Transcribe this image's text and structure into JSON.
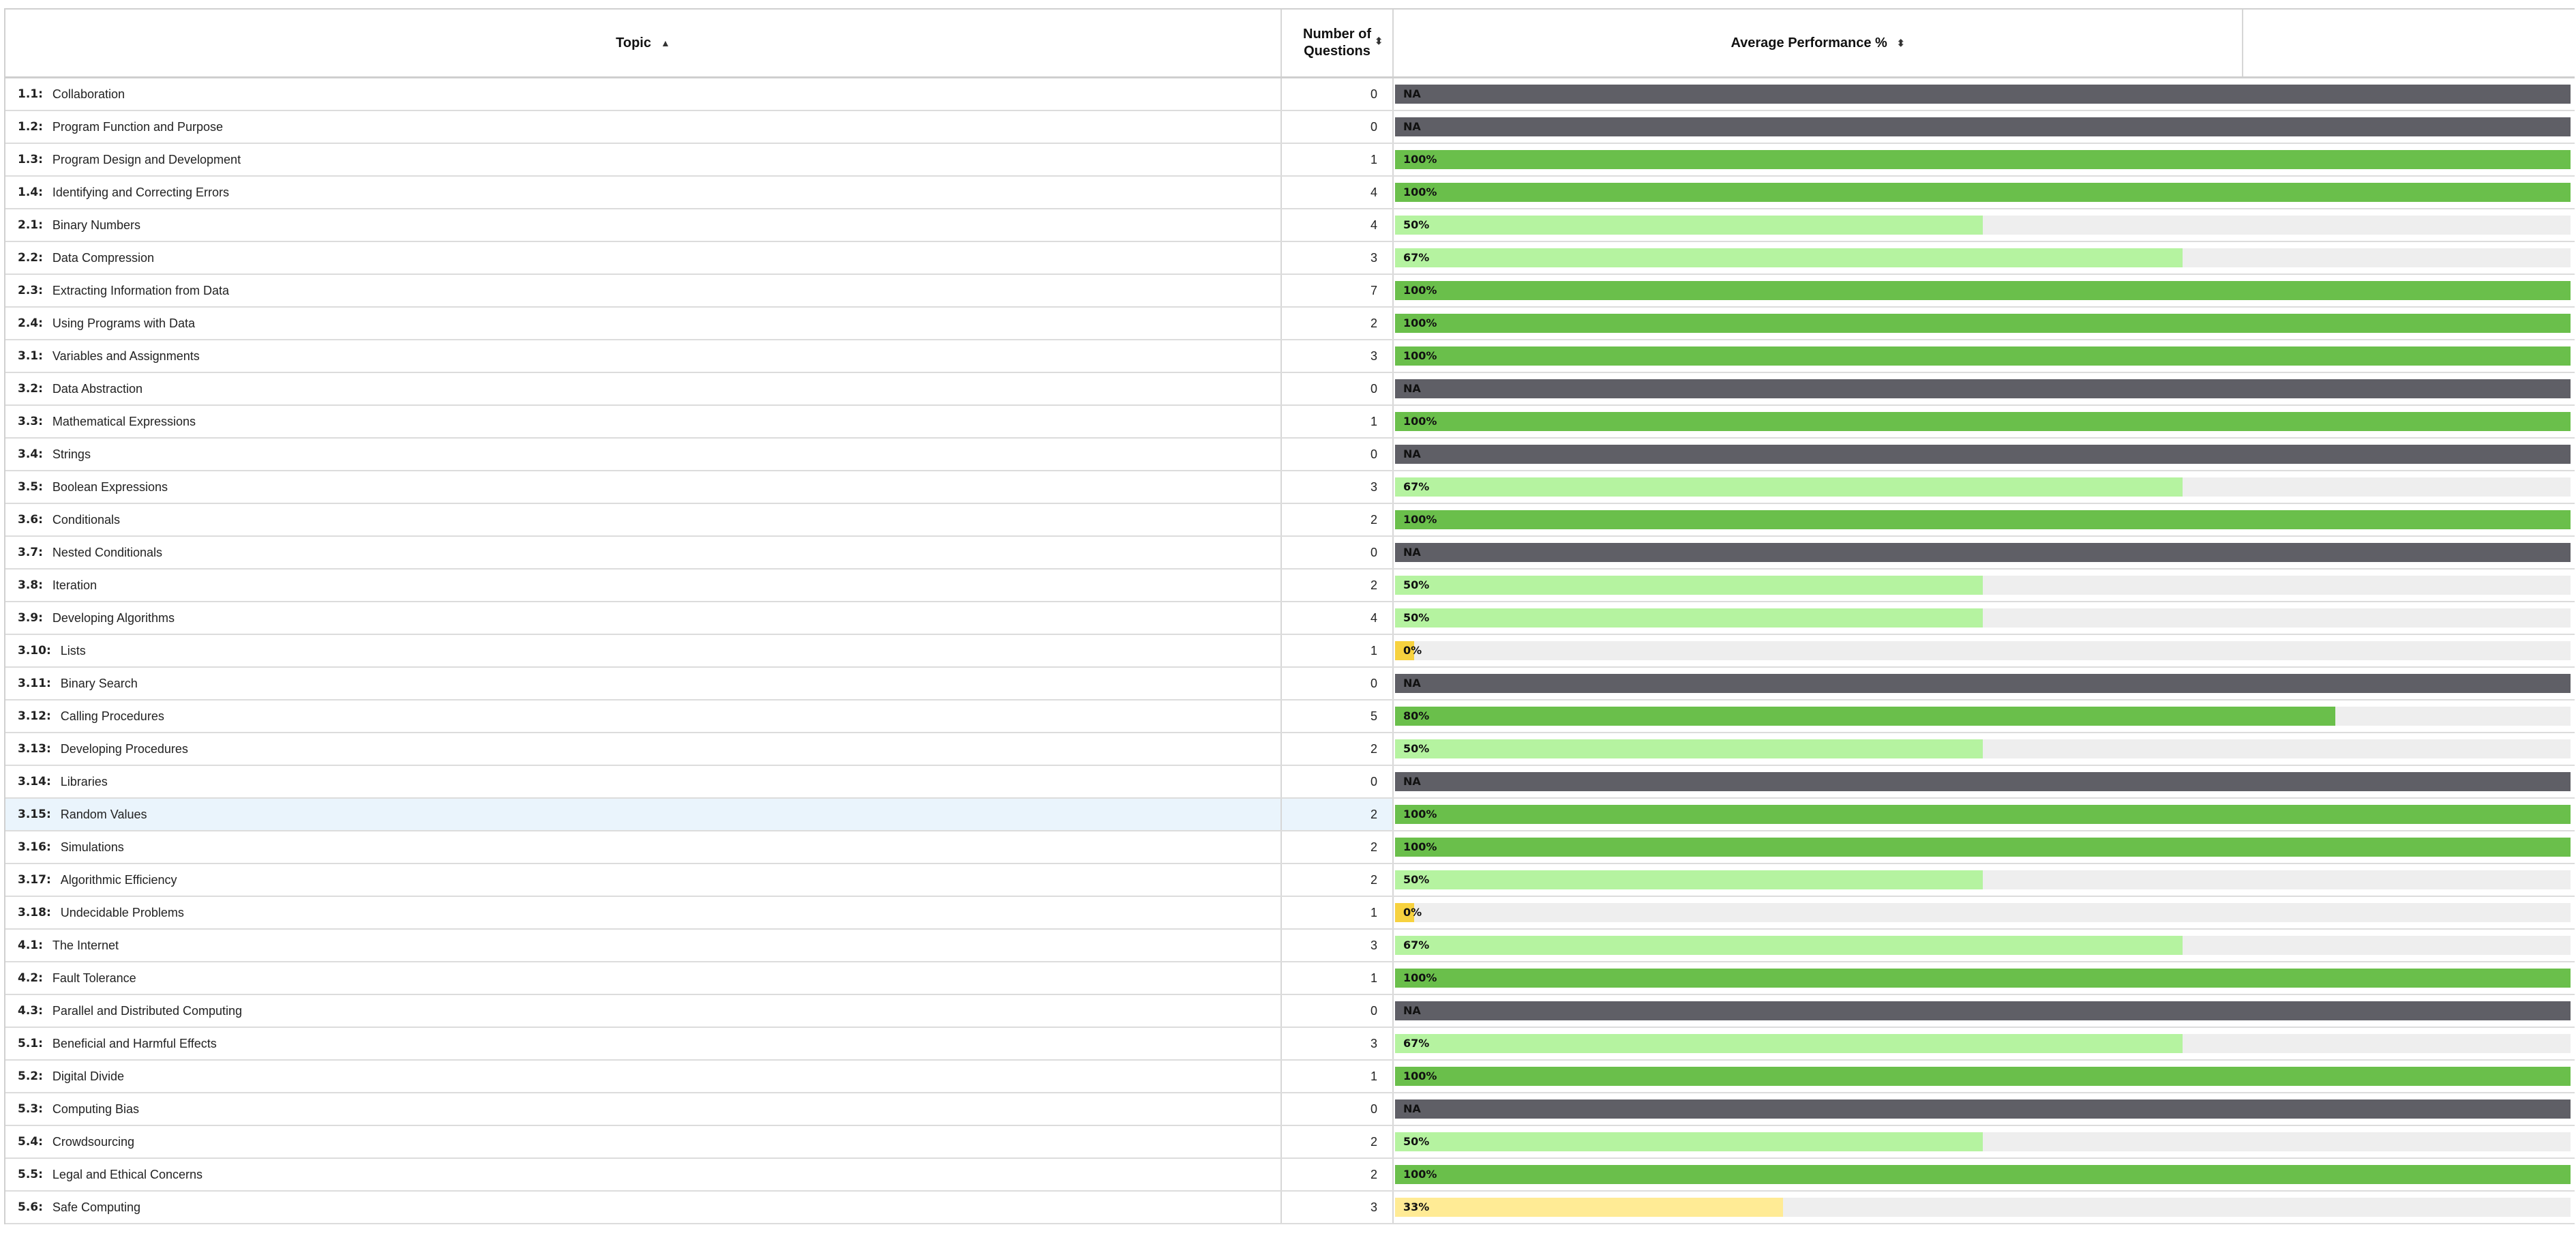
{
  "header": {
    "topic": "Topic",
    "num_questions": "Number of Questions",
    "avg_performance": "Average Performance %",
    "sort_icon": "sort-icon"
  },
  "colors": {
    "na": "#5f5f66",
    "full": "#6abf4b",
    "partial": "#b5f3a0",
    "zero": "#f7d23f",
    "low": "#ffeb95",
    "track": "#eeeeee",
    "row_highlight": "#eaf4fc"
  },
  "rows": [
    {
      "code": "1.1:",
      "topic": "Collaboration",
      "questions": "0",
      "perf": "NA",
      "value": null
    },
    {
      "code": "1.2:",
      "topic": "Program Function and Purpose",
      "questions": "0",
      "perf": "NA",
      "value": null
    },
    {
      "code": "1.3:",
      "topic": "Program Design and Development",
      "questions": "1",
      "perf": "100%",
      "value": 100
    },
    {
      "code": "1.4:",
      "topic": "Identifying and Correcting Errors",
      "questions": "4",
      "perf": "100%",
      "value": 100
    },
    {
      "code": "2.1:",
      "topic": "Binary Numbers",
      "questions": "4",
      "perf": "50%",
      "value": 50
    },
    {
      "code": "2.2:",
      "topic": "Data Compression",
      "questions": "3",
      "perf": "67%",
      "value": 67
    },
    {
      "code": "2.3:",
      "topic": "Extracting Information from Data",
      "questions": "7",
      "perf": "100%",
      "value": 100
    },
    {
      "code": "2.4:",
      "topic": "Using Programs with Data",
      "questions": "2",
      "perf": "100%",
      "value": 100
    },
    {
      "code": "3.1:",
      "topic": "Variables and Assignments",
      "questions": "3",
      "perf": "100%",
      "value": 100
    },
    {
      "code": "3.2:",
      "topic": "Data Abstraction",
      "questions": "0",
      "perf": "NA",
      "value": null
    },
    {
      "code": "3.3:",
      "topic": "Mathematical Expressions",
      "questions": "1",
      "perf": "100%",
      "value": 100
    },
    {
      "code": "3.4:",
      "topic": "Strings",
      "questions": "0",
      "perf": "NA",
      "value": null
    },
    {
      "code": "3.5:",
      "topic": "Boolean Expressions",
      "questions": "3",
      "perf": "67%",
      "value": 67
    },
    {
      "code": "3.6:",
      "topic": "Conditionals",
      "questions": "2",
      "perf": "100%",
      "value": 100
    },
    {
      "code": "3.7:",
      "topic": "Nested Conditionals",
      "questions": "0",
      "perf": "NA",
      "value": null
    },
    {
      "code": "3.8:",
      "topic": "Iteration",
      "questions": "2",
      "perf": "50%",
      "value": 50
    },
    {
      "code": "3.9:",
      "topic": "Developing Algorithms",
      "questions": "4",
      "perf": "50%",
      "value": 50
    },
    {
      "code": "3.10:",
      "topic": "Lists",
      "questions": "1",
      "perf": "0%",
      "value": 0
    },
    {
      "code": "3.11:",
      "topic": "Binary Search",
      "questions": "0",
      "perf": "NA",
      "value": null
    },
    {
      "code": "3.12:",
      "topic": "Calling Procedures",
      "questions": "5",
      "perf": "80%",
      "value": 80
    },
    {
      "code": "3.13:",
      "topic": "Developing Procedures",
      "questions": "2",
      "perf": "50%",
      "value": 50
    },
    {
      "code": "3.14:",
      "topic": "Libraries",
      "questions": "0",
      "perf": "NA",
      "value": null
    },
    {
      "code": "3.15:",
      "topic": "Random Values",
      "questions": "2",
      "perf": "100%",
      "value": 100,
      "highlight": true
    },
    {
      "code": "3.16:",
      "topic": "Simulations",
      "questions": "2",
      "perf": "100%",
      "value": 100
    },
    {
      "code": "3.17:",
      "topic": "Algorithmic Efficiency",
      "questions": "2",
      "perf": "50%",
      "value": 50
    },
    {
      "code": "3.18:",
      "topic": "Undecidable Problems",
      "questions": "1",
      "perf": "0%",
      "value": 0
    },
    {
      "code": "4.1:",
      "topic": "The Internet",
      "questions": "3",
      "perf": "67%",
      "value": 67
    },
    {
      "code": "4.2:",
      "topic": "Fault Tolerance",
      "questions": "1",
      "perf": "100%",
      "value": 100
    },
    {
      "code": "4.3:",
      "topic": "Parallel and Distributed Computing",
      "questions": "0",
      "perf": "NA",
      "value": null
    },
    {
      "code": "5.1:",
      "topic": "Beneficial and Harmful Effects",
      "questions": "3",
      "perf": "67%",
      "value": 67
    },
    {
      "code": "5.2:",
      "topic": "Digital Divide",
      "questions": "1",
      "perf": "100%",
      "value": 100
    },
    {
      "code": "5.3:",
      "topic": "Computing Bias",
      "questions": "0",
      "perf": "NA",
      "value": null
    },
    {
      "code": "5.4:",
      "topic": "Crowdsourcing",
      "questions": "2",
      "perf": "50%",
      "value": 50
    },
    {
      "code": "5.5:",
      "topic": "Legal and Ethical Concerns",
      "questions": "2",
      "perf": "100%",
      "value": 100
    },
    {
      "code": "5.6:",
      "topic": "Safe Computing",
      "questions": "3",
      "perf": "33%",
      "value": 33
    }
  ]
}
